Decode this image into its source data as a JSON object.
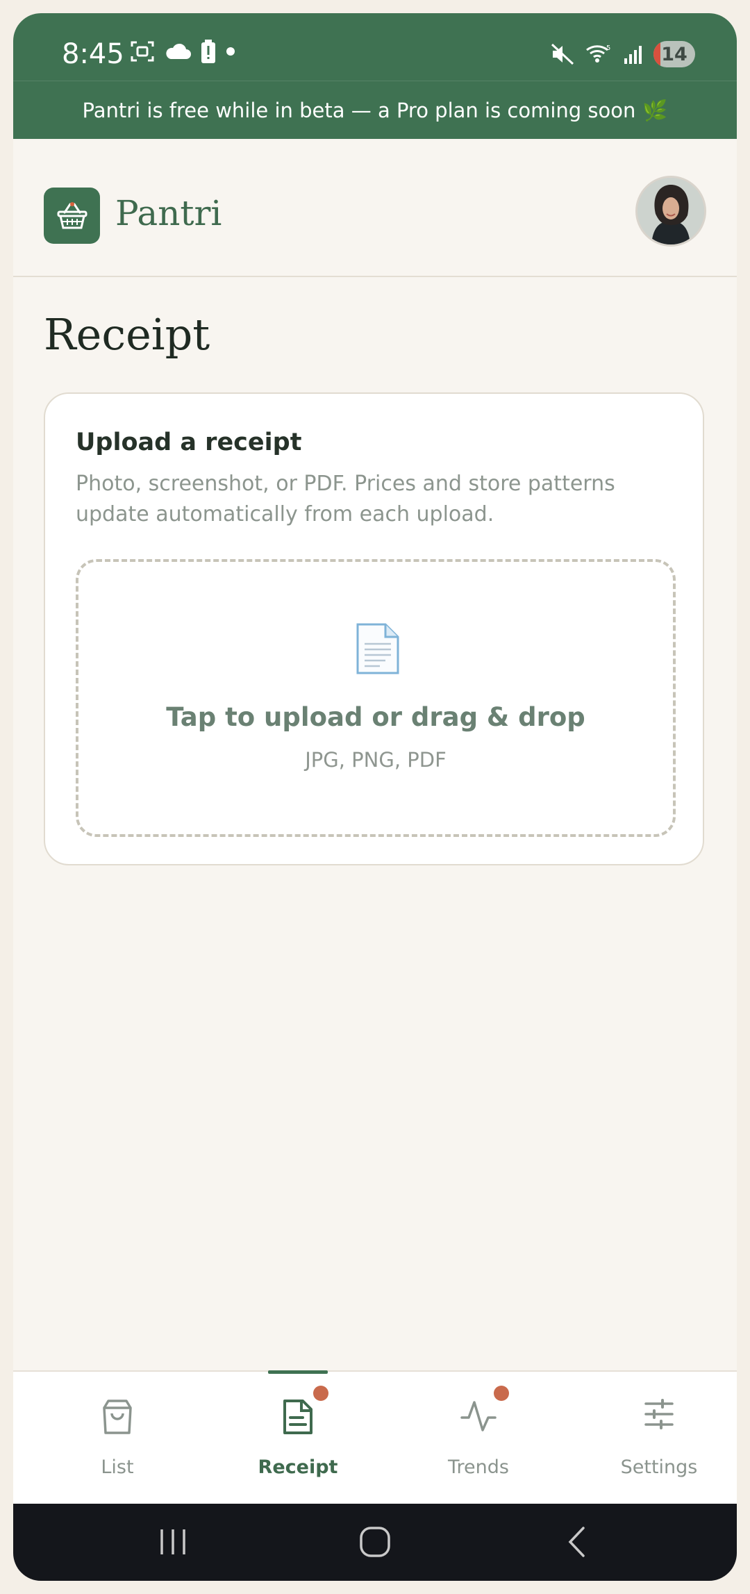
{
  "status_bar": {
    "time": "8:45",
    "battery_level": "14",
    "icons_left": [
      "screenshot-icon",
      "cloud-icon",
      "battery-alert-icon",
      "dot-icon"
    ],
    "icons_right": [
      "mute-icon",
      "wifi-icon",
      "signal-icon"
    ]
  },
  "banner": {
    "text": "Pantri is free while in beta — a Pro plan is coming soon",
    "emoji": "🌿"
  },
  "header": {
    "brand": "Pantri",
    "logo_icon": "basket-icon",
    "avatar": "user-avatar"
  },
  "page": {
    "title": "Receipt"
  },
  "upload_card": {
    "title": "Upload a receipt",
    "description": "Photo, screenshot, or PDF. Prices and store patterns update automatically from each upload.",
    "dropzone_text": "Tap to upload or drag & drop",
    "dropzone_formats": "JPG, PNG, PDF",
    "icon": "document-icon"
  },
  "tabs": [
    {
      "label": "List",
      "icon": "shopping-bag-icon",
      "active": false,
      "badge": false
    },
    {
      "label": "Receipt",
      "icon": "receipt-icon",
      "active": true,
      "badge": true
    },
    {
      "label": "Trends",
      "icon": "activity-icon",
      "active": false,
      "badge": true
    },
    {
      "label": "Settings",
      "icon": "sliders-icon",
      "active": false,
      "badge": false
    }
  ],
  "colors": {
    "brand_green": "#3f7252",
    "badge": "#c96a4c",
    "background": "#f8f5f0"
  }
}
